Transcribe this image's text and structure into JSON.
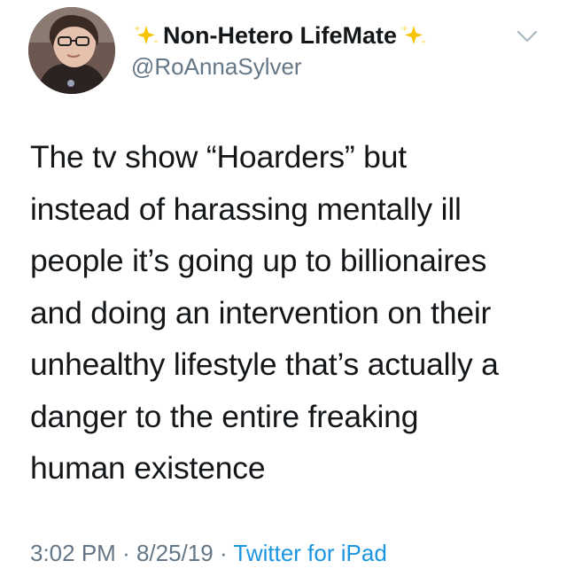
{
  "author": {
    "display_name": "Non-Hetero LifeMate",
    "handle": "@RoAnnaSylver",
    "avatar_icon": "profile-photo",
    "name_decoration_icon": "sparkles-icon"
  },
  "tweet": {
    "text": "The tv show “Hoarders” but\ninstead of harassing mentally ill\npeople it’s going up to billionaires\nand doing an intervention on their\nunhealthy lifestyle that’s actually a\ndanger to the entire freaking\nhuman existence",
    "time": "3:02 PM",
    "separator": "·",
    "date": "8/25/19",
    "source": "Twitter for iPad"
  },
  "menu": {
    "icon": "chevron-down-icon"
  },
  "colors": {
    "text": "#14171a",
    "secondary": "#657786",
    "link": "#1b95e0",
    "sparkle_yellow": "#f5c400",
    "sparkle_light": "#fde68a"
  }
}
